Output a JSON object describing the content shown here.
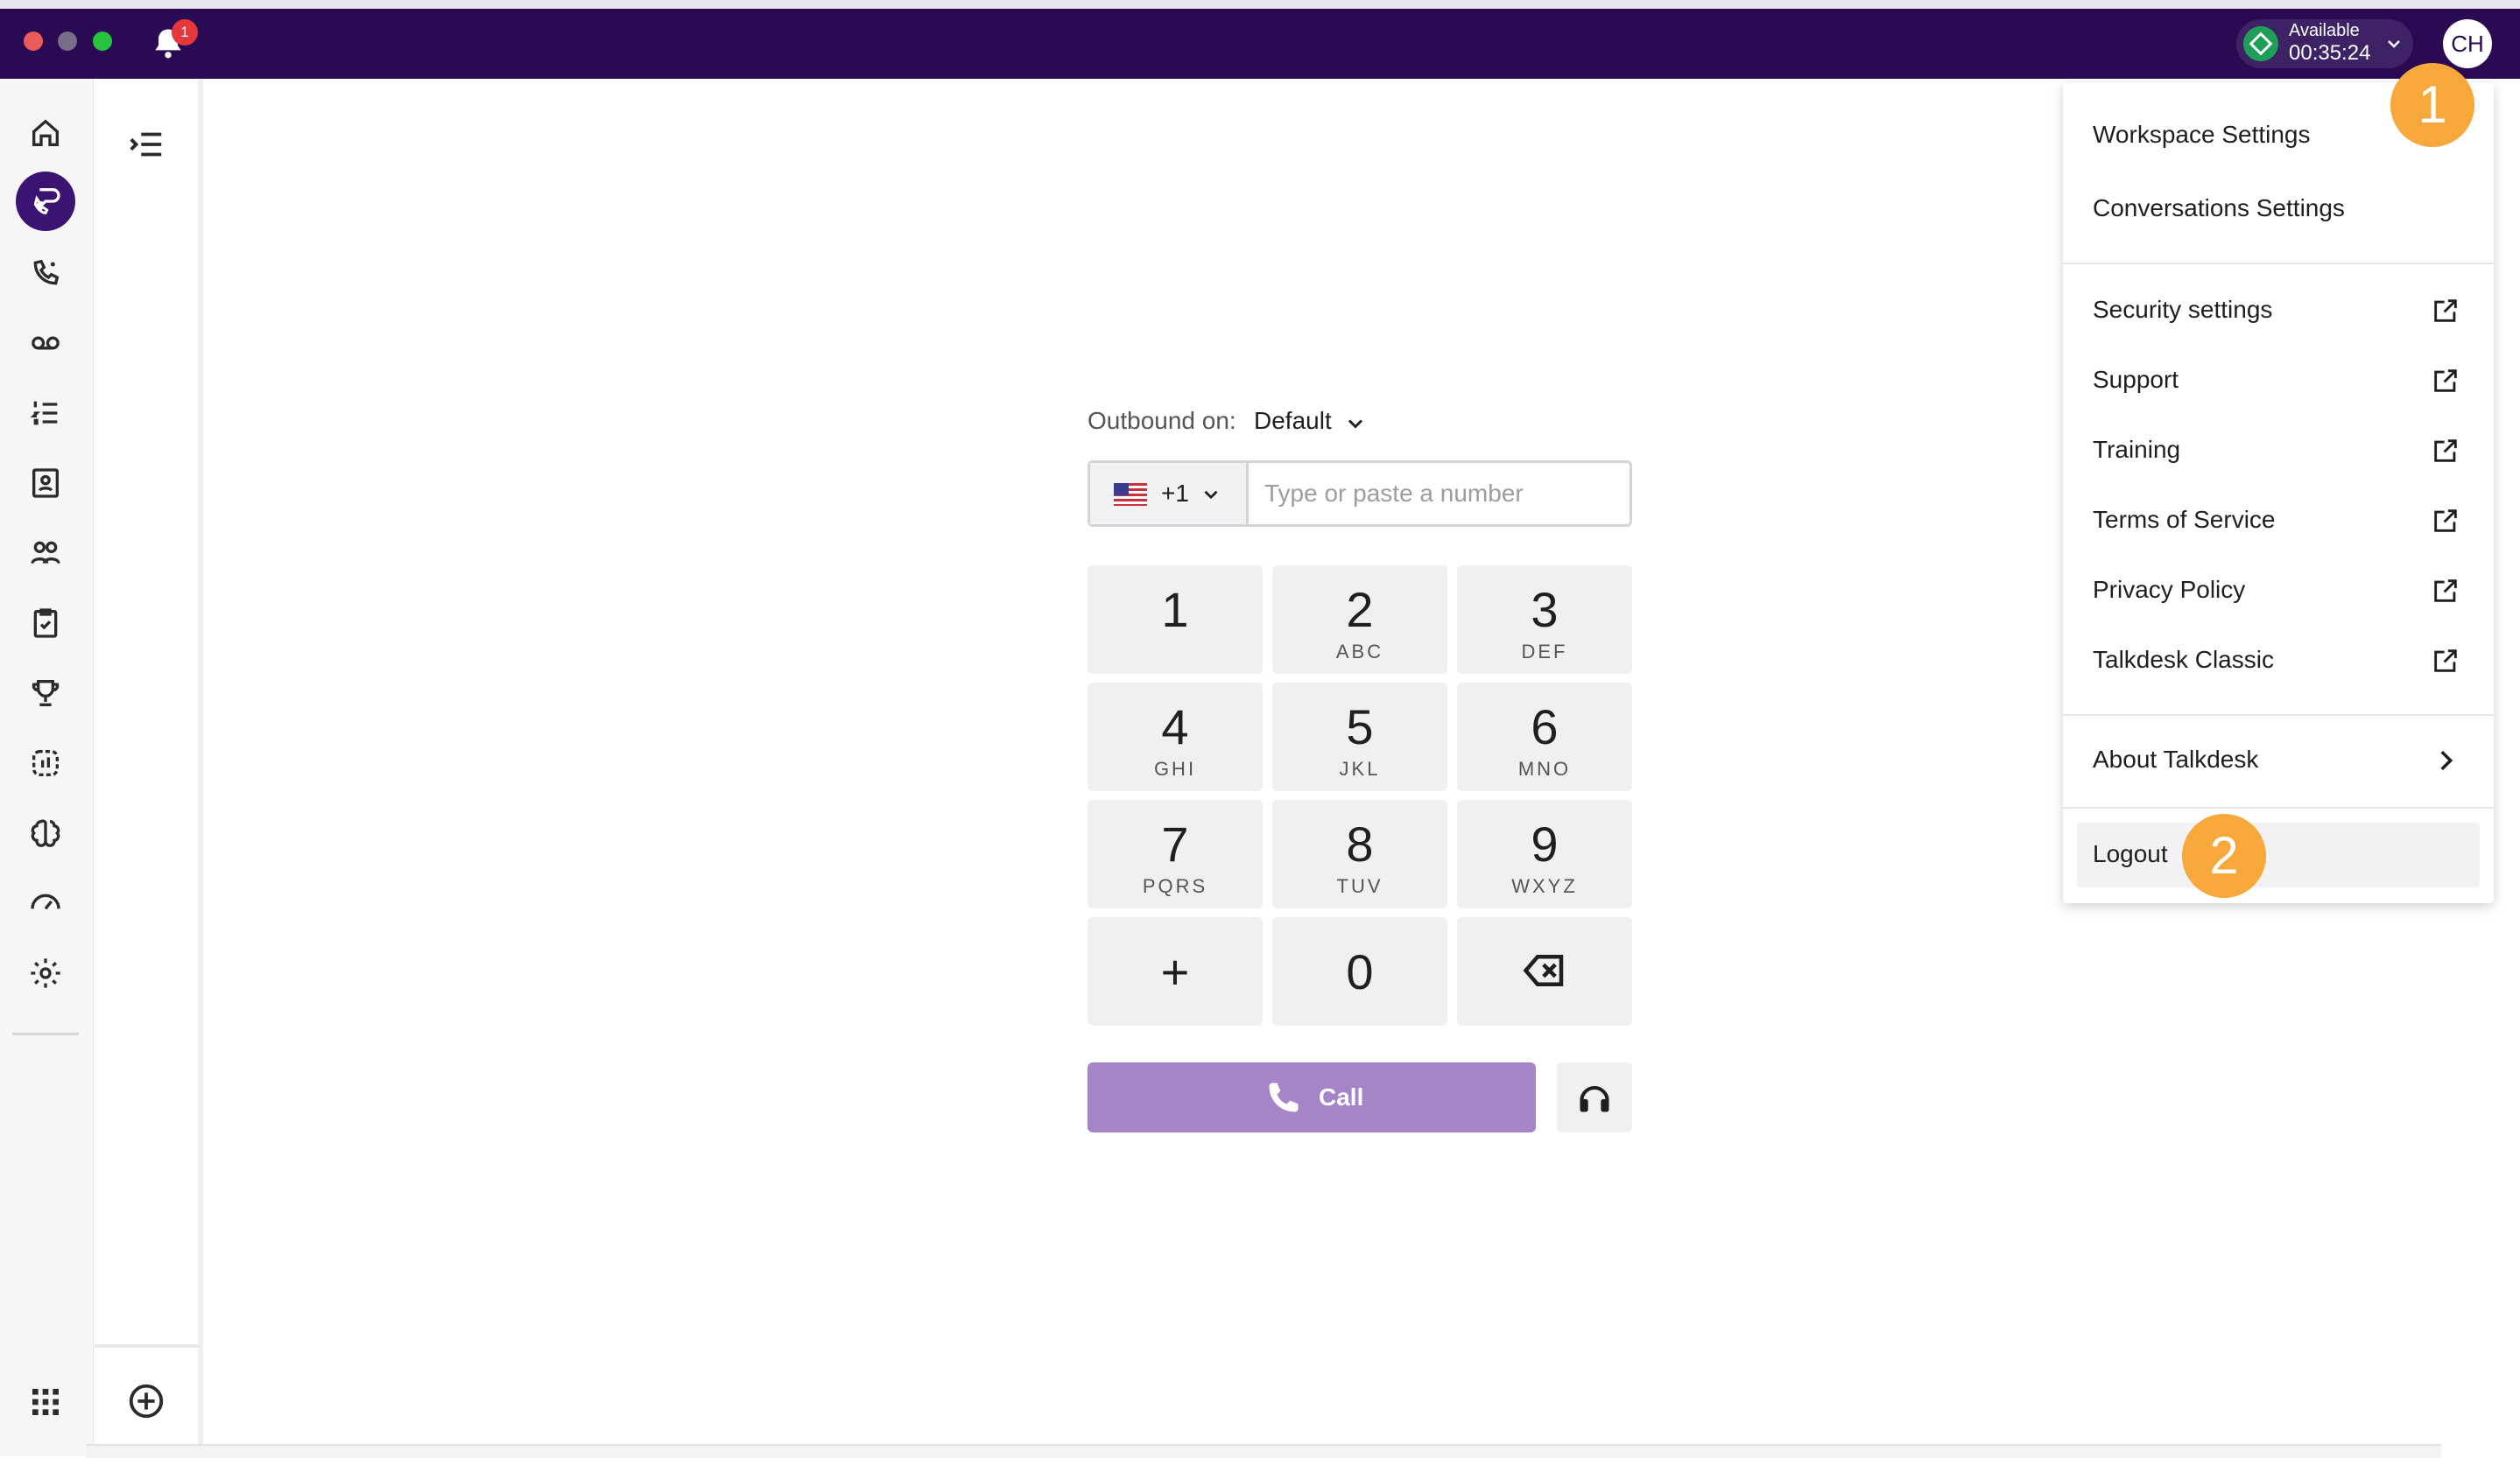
{
  "topbar": {
    "notification_count": "1",
    "status_label": "Available",
    "status_timer": "00:35:24",
    "avatar_initials": "CH"
  },
  "dialer": {
    "outbound_label": "Outbound on:",
    "outbound_value": "Default",
    "country_code": "+1",
    "phone_placeholder": "Type or paste a number",
    "keys": [
      {
        "digit": "1",
        "letters": ""
      },
      {
        "digit": "2",
        "letters": "ABC"
      },
      {
        "digit": "3",
        "letters": "DEF"
      },
      {
        "digit": "4",
        "letters": "GHI"
      },
      {
        "digit": "5",
        "letters": "JKL"
      },
      {
        "digit": "6",
        "letters": "MNO"
      },
      {
        "digit": "7",
        "letters": "PQRS"
      },
      {
        "digit": "8",
        "letters": "TUV"
      },
      {
        "digit": "9",
        "letters": "WXYZ"
      },
      {
        "digit": "+",
        "letters": ""
      },
      {
        "digit": "0",
        "letters": ""
      }
    ],
    "call_label": "Call"
  },
  "menu": {
    "items": [
      {
        "label": "Workspace Settings"
      },
      {
        "label": "Conversations Settings"
      },
      {
        "label": "Security settings"
      },
      {
        "label": "Support"
      },
      {
        "label": "Training"
      },
      {
        "label": "Terms of Service"
      },
      {
        "label": "Privacy Policy"
      },
      {
        "label": "Talkdesk Classic"
      },
      {
        "label": "About Talkdesk"
      },
      {
        "label": "Logout"
      }
    ]
  },
  "markers": [
    "1",
    "2"
  ],
  "colors": {
    "topbar": "#2a0a52",
    "rail_active": "#3b1473",
    "call_button": "#a585c7",
    "status_green": "#1e9e58",
    "marker": "#f7a83b"
  }
}
